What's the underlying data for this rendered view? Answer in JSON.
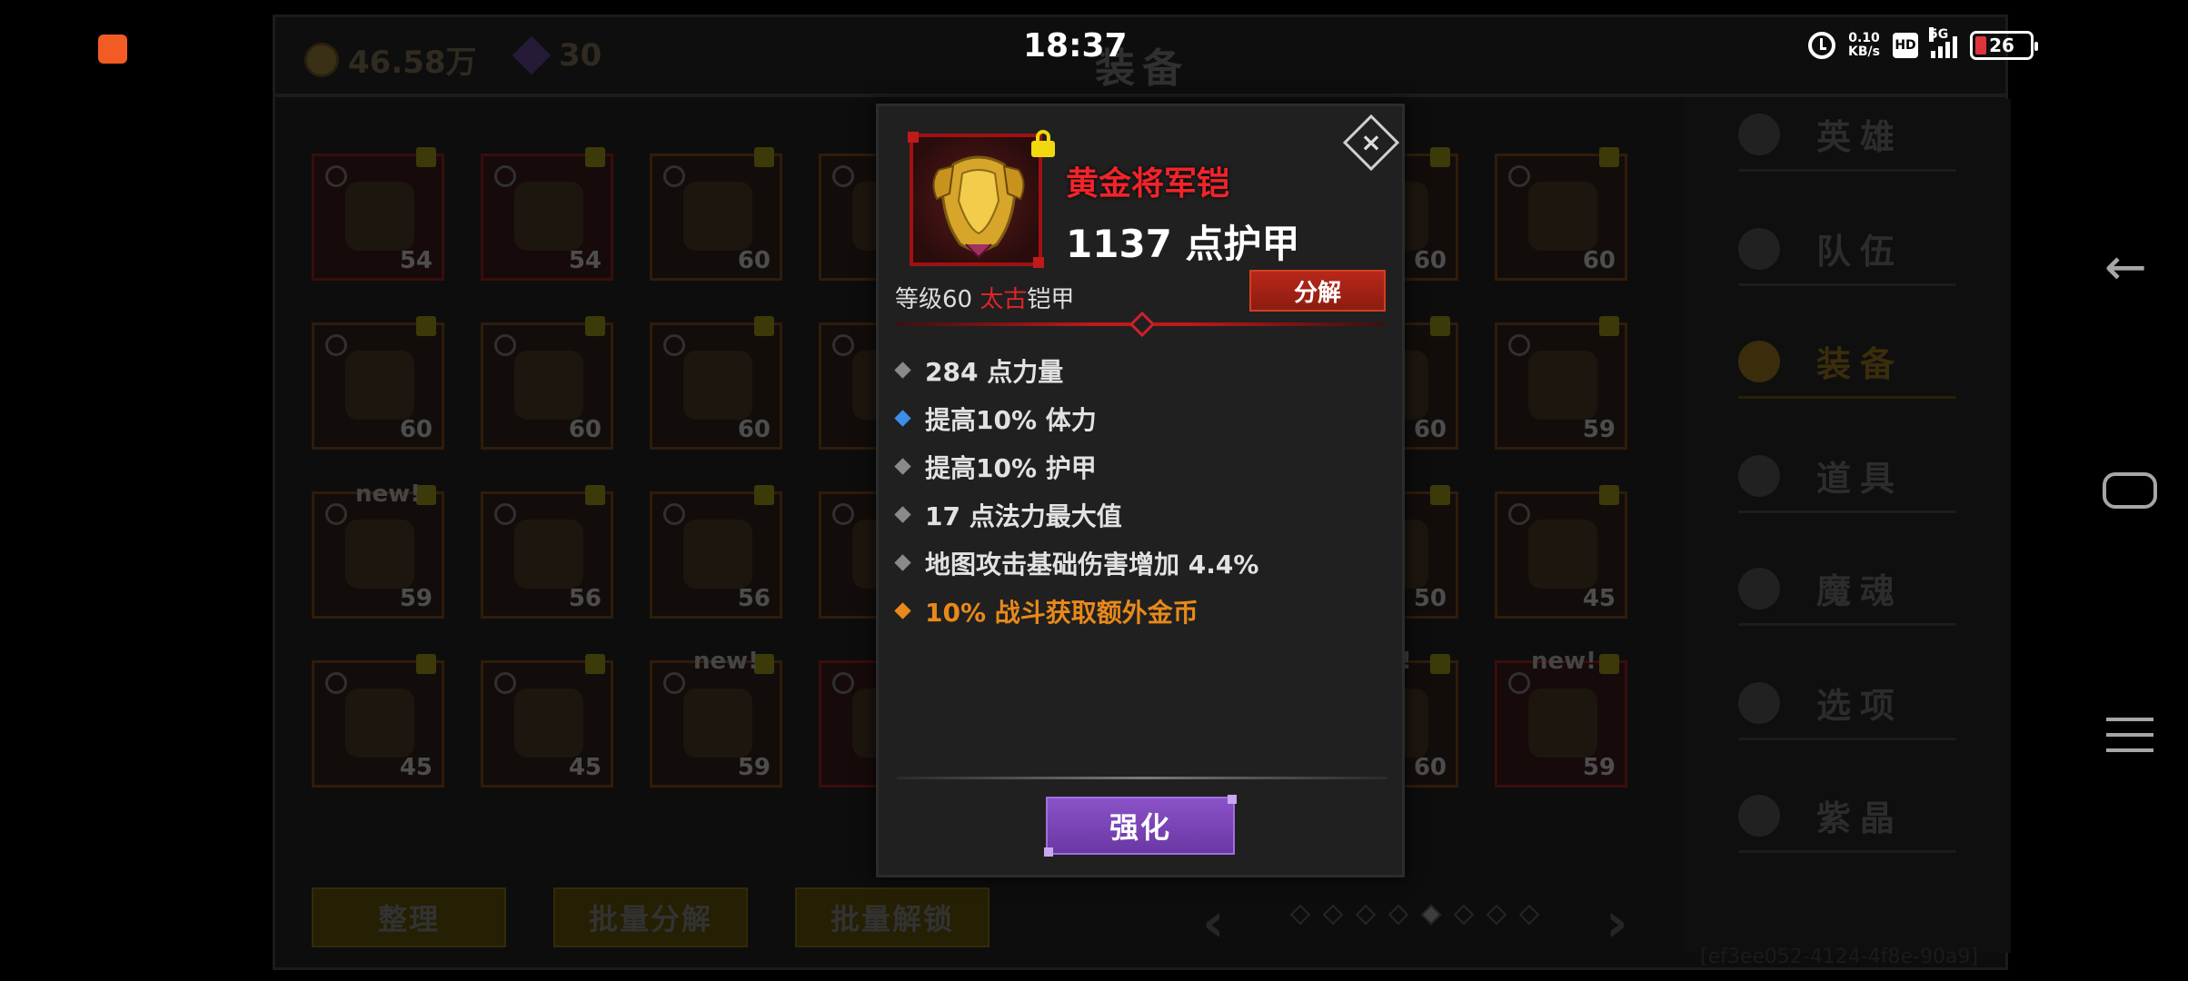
{
  "status": {
    "time": "18:37",
    "net_speed_value": "0.10",
    "net_speed_unit": "KB/s",
    "hd": "HD",
    "network": "5G",
    "battery": "26"
  },
  "header": {
    "gold": "46.58万",
    "gems": "30",
    "title": "装备"
  },
  "grid": {
    "items": [
      {
        "level": "54",
        "rarity": "red"
      },
      {
        "level": "54",
        "rarity": "red"
      },
      {
        "level": "60",
        "rarity": "normal"
      },
      {
        "level": "",
        "rarity": "normal"
      },
      {
        "level": "60",
        "rarity": "normal"
      },
      {
        "level": "60",
        "rarity": "normal"
      },
      {
        "level": "60",
        "rarity": "normal"
      },
      {
        "level": "60",
        "rarity": "normal"
      },
      {
        "level": "60",
        "rarity": "normal"
      },
      {
        "level": "",
        "rarity": "normal"
      },
      {
        "level": "60",
        "rarity": "normal"
      },
      {
        "level": "59",
        "rarity": "normal"
      },
      {
        "level": "59",
        "rarity": "normal"
      },
      {
        "level": "56",
        "rarity": "normal"
      },
      {
        "level": "56",
        "rarity": "normal"
      },
      {
        "level": "",
        "rarity": "normal"
      },
      {
        "level": "50",
        "rarity": "normal"
      },
      {
        "level": "45",
        "rarity": "normal"
      },
      {
        "level": "45",
        "rarity": "normal"
      },
      {
        "level": "45",
        "rarity": "normal"
      },
      {
        "level": "59",
        "rarity": "normal"
      },
      {
        "level": "",
        "rarity": "red"
      },
      {
        "level": "60",
        "rarity": "normal"
      },
      {
        "level": "59",
        "rarity": "red"
      }
    ],
    "new_label": "new!",
    "new_label_partial": "v!"
  },
  "bottom": {
    "sort": "整理",
    "batch_decompose": "批量分解",
    "batch_unlock": "批量解锁",
    "prev": "‹",
    "next": "›"
  },
  "side_menu": {
    "items": [
      {
        "label": "英雄"
      },
      {
        "label": "队伍"
      },
      {
        "label": "装备"
      },
      {
        "label": "道具"
      },
      {
        "label": "魔魂"
      },
      {
        "label": "选项"
      },
      {
        "label": "紫晶"
      }
    ]
  },
  "uuid": "[ef3ee052-4124-4f8e-90a9]",
  "popup": {
    "item_name": "黄金将军铠",
    "armor_value": "1137 点护甲",
    "grade_prefix": "等级60",
    "grade_tier": "太古",
    "grade_type": "铠甲",
    "decompose": "分解",
    "close": "×",
    "stats": [
      {
        "text": "284 点力量",
        "kind": "normal"
      },
      {
        "text": "提高10% 体力",
        "kind": "blue"
      },
      {
        "text": "提高10% 护甲",
        "kind": "normal"
      },
      {
        "text": "17 点法力最大值",
        "kind": "normal"
      },
      {
        "text": "地图攻击基础伤害增加 4.4%",
        "kind": "normal"
      },
      {
        "text": "10% 战斗获取额外金币",
        "kind": "gold"
      }
    ],
    "enhance": "强化"
  }
}
